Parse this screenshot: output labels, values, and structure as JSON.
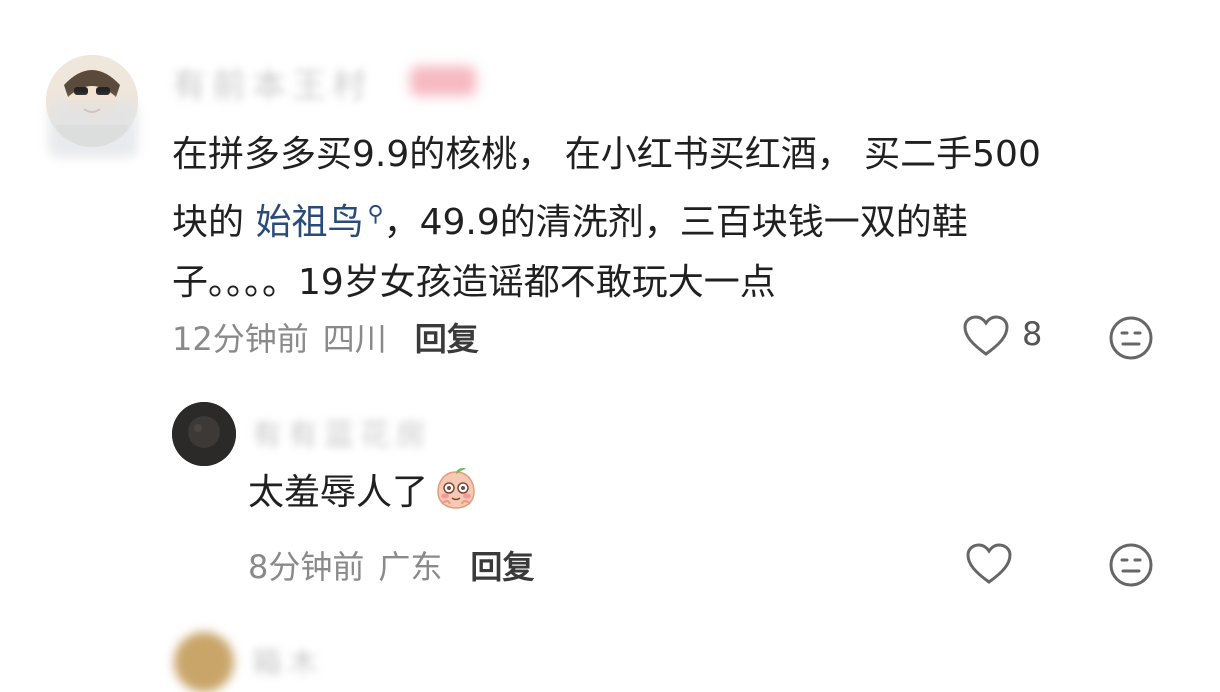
{
  "comments": [
    {
      "name": "有前本王村",
      "badge": "作者",
      "text_line1": "在拼多多买9.9的核桃， 在小红书买红酒， 买二手500",
      "text_line2_a": "块的 ",
      "link_text": "始祖鸟",
      "text_line2_b": "，49.9的清洗剂，三百块钱一双的鞋",
      "text_line3": "子。。。。19岁女孩造谣都不敢玩大一点",
      "time": "12分钟前",
      "location": "四川",
      "reply_label": "回复",
      "like_count": "8"
    },
    {
      "name": "有有蓝花房",
      "text": "太羞辱人了",
      "time": "8分钟前",
      "location": "广东",
      "reply_label": "回复"
    },
    {
      "name": "箱木"
    }
  ],
  "icons": {
    "heart": "heart-outline-icon",
    "meh": "meh-face-icon",
    "emoji": "shy-peach-emoji-icon",
    "link_mark": "search-mark-icon"
  }
}
